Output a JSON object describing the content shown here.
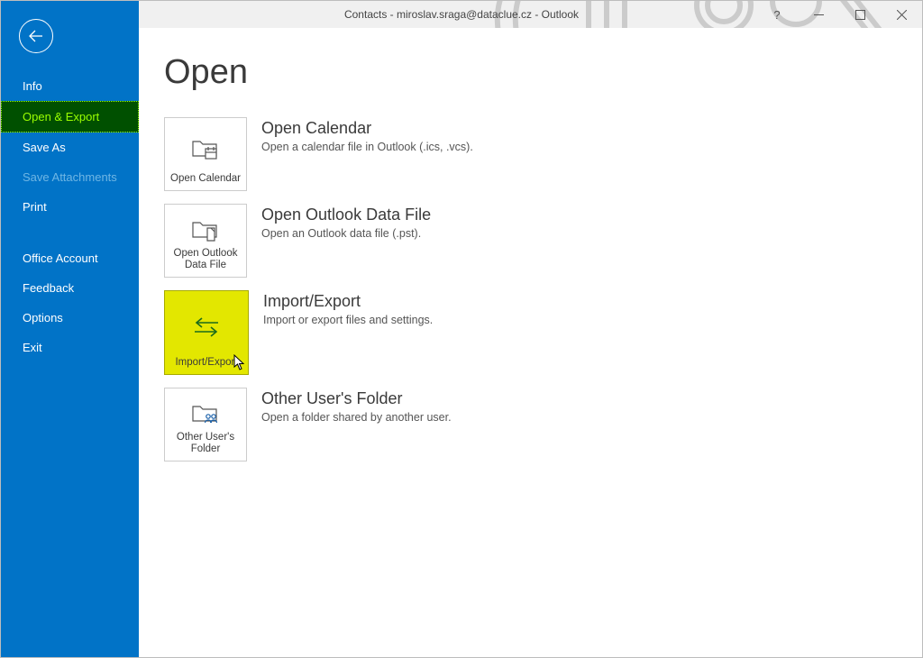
{
  "window": {
    "title": "Contacts - miroslav.sraga@dataclue.cz - Outlook"
  },
  "sidebar": {
    "items": [
      {
        "label": "Info"
      },
      {
        "label": "Open & Export",
        "selected": true
      },
      {
        "label": "Save As"
      },
      {
        "label": "Save Attachments",
        "disabled": true
      },
      {
        "label": "Print"
      }
    ],
    "secondary": [
      {
        "label": "Office Account"
      },
      {
        "label": "Feedback"
      },
      {
        "label": "Options"
      },
      {
        "label": "Exit"
      }
    ]
  },
  "page": {
    "title": "Open",
    "options": [
      {
        "tile_label": "Open Calendar",
        "title": "Open Calendar",
        "subtitle": "Open a calendar file in Outlook (.ics, .vcs).",
        "icon": "calendar-folder-icon"
      },
      {
        "tile_label": "Open Outlook Data File",
        "title": "Open Outlook Data File",
        "subtitle": "Open an Outlook data file (.pst).",
        "icon": "data-file-icon"
      },
      {
        "tile_label": "Import/Export",
        "title": "Import/Export",
        "subtitle": "Import or export files and settings.",
        "icon": "import-export-icon",
        "highlight": true
      },
      {
        "tile_label": "Other User's Folder",
        "title": "Other User's Folder",
        "subtitle": "Open a folder shared by another user.",
        "icon": "shared-folder-icon"
      }
    ]
  }
}
